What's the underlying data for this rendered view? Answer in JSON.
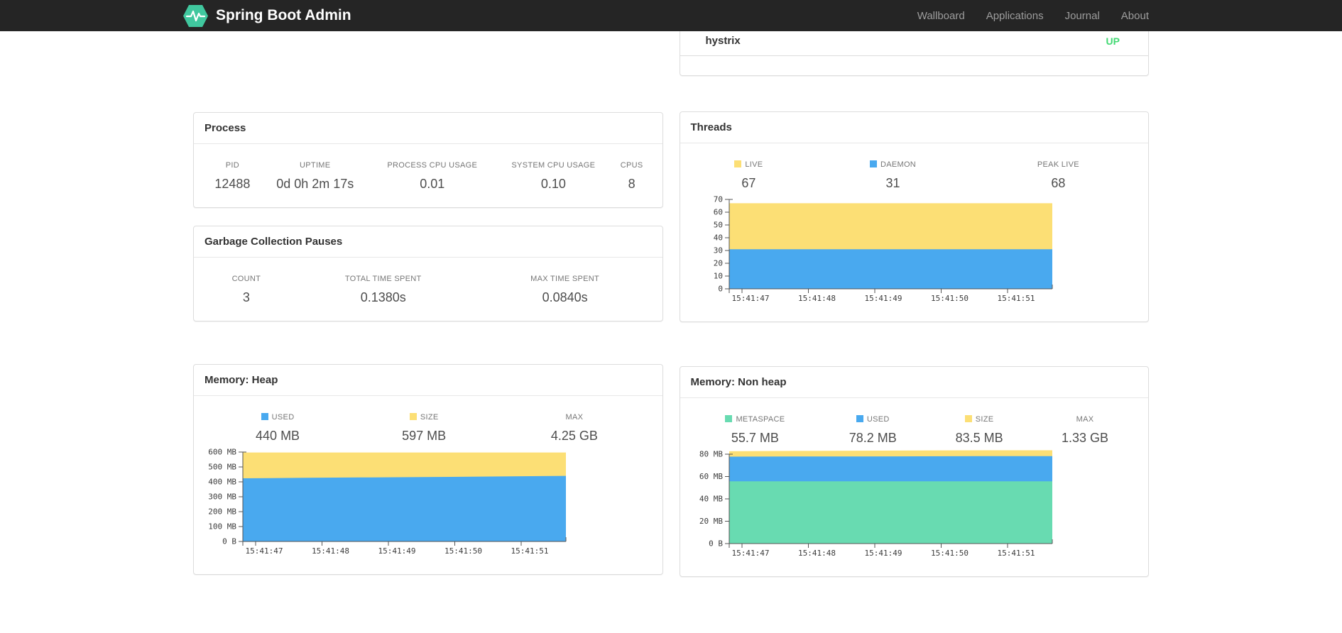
{
  "colors": {
    "navbar_bg": "#252525",
    "brand_green": "#40c79e",
    "status_up_green": "#42d973",
    "chart_yellow": "#fcdf75",
    "chart_blue": "#49a9ef",
    "chart_green": "#68dbb1"
  },
  "navbar": {
    "brand": "Spring Boot Admin",
    "items": [
      {
        "label": "Wallboard"
      },
      {
        "label": "Applications"
      },
      {
        "label": "Journal"
      },
      {
        "label": "About"
      }
    ]
  },
  "application_card": {
    "name": "hystrix",
    "status": "UP"
  },
  "cards": {
    "process": {
      "title": "Process",
      "stats": [
        {
          "label": "PID",
          "value": "12488"
        },
        {
          "label": "UPTIME",
          "value": "0d 0h 2m 17s"
        },
        {
          "label": "PROCESS CPU USAGE",
          "value": "0.01"
        },
        {
          "label": "SYSTEM CPU USAGE",
          "value": "0.10"
        },
        {
          "label": "CPUS",
          "value": "8"
        }
      ]
    },
    "gc": {
      "title": "Garbage Collection Pauses",
      "stats": [
        {
          "label": "COUNT",
          "value": "3"
        },
        {
          "label": "TOTAL TIME SPENT",
          "value": "0.1380s"
        },
        {
          "label": "MAX TIME SPENT",
          "value": "0.0840s"
        }
      ]
    },
    "threads": {
      "title": "Threads",
      "stats": [
        {
          "label": "LIVE",
          "value": "67",
          "marker": "#fcdf75"
        },
        {
          "label": "DAEMON",
          "value": "31",
          "marker": "#49a9ef"
        },
        {
          "label": "PEAK LIVE",
          "value": "68"
        }
      ],
      "chart": {
        "type": "area",
        "x_labels": [
          "15:41:47",
          "15:41:48",
          "15:41:49",
          "15:41:50",
          "15:41:51"
        ],
        "y_ticks": [
          {
            "value": 0,
            "label": "0"
          },
          {
            "value": 10,
            "label": "10"
          },
          {
            "value": 20,
            "label": "20"
          },
          {
            "value": 30,
            "label": "30"
          },
          {
            "value": 40,
            "label": "40"
          },
          {
            "value": 50,
            "label": "50"
          },
          {
            "value": 60,
            "label": "60"
          },
          {
            "value": 70,
            "label": "70"
          }
        ],
        "series": [
          {
            "name": "DAEMON",
            "color": "#49a9ef",
            "values": [
              31,
              31,
              31,
              31,
              31,
              31
            ]
          },
          {
            "name": "LIVE",
            "color": "#fcdf75",
            "values": [
              67,
              67,
              67,
              67,
              67,
              67
            ]
          }
        ]
      }
    },
    "heap": {
      "title": "Memory: Heap",
      "stats": [
        {
          "label": "USED",
          "value": "440 MB",
          "marker": "#49a9ef"
        },
        {
          "label": "SIZE",
          "value": "597 MB",
          "marker": "#fcdf75"
        },
        {
          "label": "MAX",
          "value": "4.25 GB"
        }
      ],
      "chart": {
        "type": "area",
        "x_labels": [
          "15:41:47",
          "15:41:48",
          "15:41:49",
          "15:41:50",
          "15:41:51"
        ],
        "y_ticks": [
          {
            "value": 0,
            "label": "0 B"
          },
          {
            "value": 100,
            "label": "100 MB"
          },
          {
            "value": 200,
            "label": "200 MB"
          },
          {
            "value": 300,
            "label": "300 MB"
          },
          {
            "value": 400,
            "label": "400 MB"
          },
          {
            "value": 500,
            "label": "500 MB"
          },
          {
            "value": 600,
            "label": "600 MB"
          }
        ],
        "series": [
          {
            "name": "USED",
            "color": "#49a9ef",
            "values": [
              424,
              427,
              430,
              433,
              436,
              440
            ]
          },
          {
            "name": "SIZE",
            "color": "#fcdf75",
            "values": [
              597,
              597,
              597,
              597,
              597,
              597
            ]
          }
        ]
      }
    },
    "nonheap": {
      "title": "Memory: Non heap",
      "stats": [
        {
          "label": "METASPACE",
          "value": "55.7 MB",
          "marker": "#68dbb1"
        },
        {
          "label": "USED",
          "value": "78.2 MB",
          "marker": "#49a9ef"
        },
        {
          "label": "SIZE",
          "value": "83.5 MB",
          "marker": "#fcdf75"
        },
        {
          "label": "MAX",
          "value": "1.33 GB"
        }
      ],
      "chart": {
        "type": "area",
        "x_labels": [
          "15:41:47",
          "15:41:48",
          "15:41:49",
          "15:41:50",
          "15:41:51"
        ],
        "y_ticks": [
          {
            "value": 0,
            "label": "0 B"
          },
          {
            "value": 20,
            "label": "20 MB"
          },
          {
            "value": 40,
            "label": "40 MB"
          },
          {
            "value": 60,
            "label": "60 MB"
          },
          {
            "value": 80,
            "label": "80 MB"
          }
        ],
        "series": [
          {
            "name": "METASPACE",
            "color": "#68dbb1",
            "values": [
              55.7,
              55.7,
              55.7,
              55.7,
              55.7,
              55.7
            ]
          },
          {
            "name": "USED",
            "color": "#49a9ef",
            "values": [
              77.8,
              78.0,
              78.0,
              78.1,
              78.2,
              78.2
            ]
          },
          {
            "name": "SIZE",
            "color": "#fcdf75",
            "values": [
              82.6,
              82.9,
              83.1,
              83.3,
              83.5,
              83.5
            ]
          }
        ]
      }
    }
  }
}
